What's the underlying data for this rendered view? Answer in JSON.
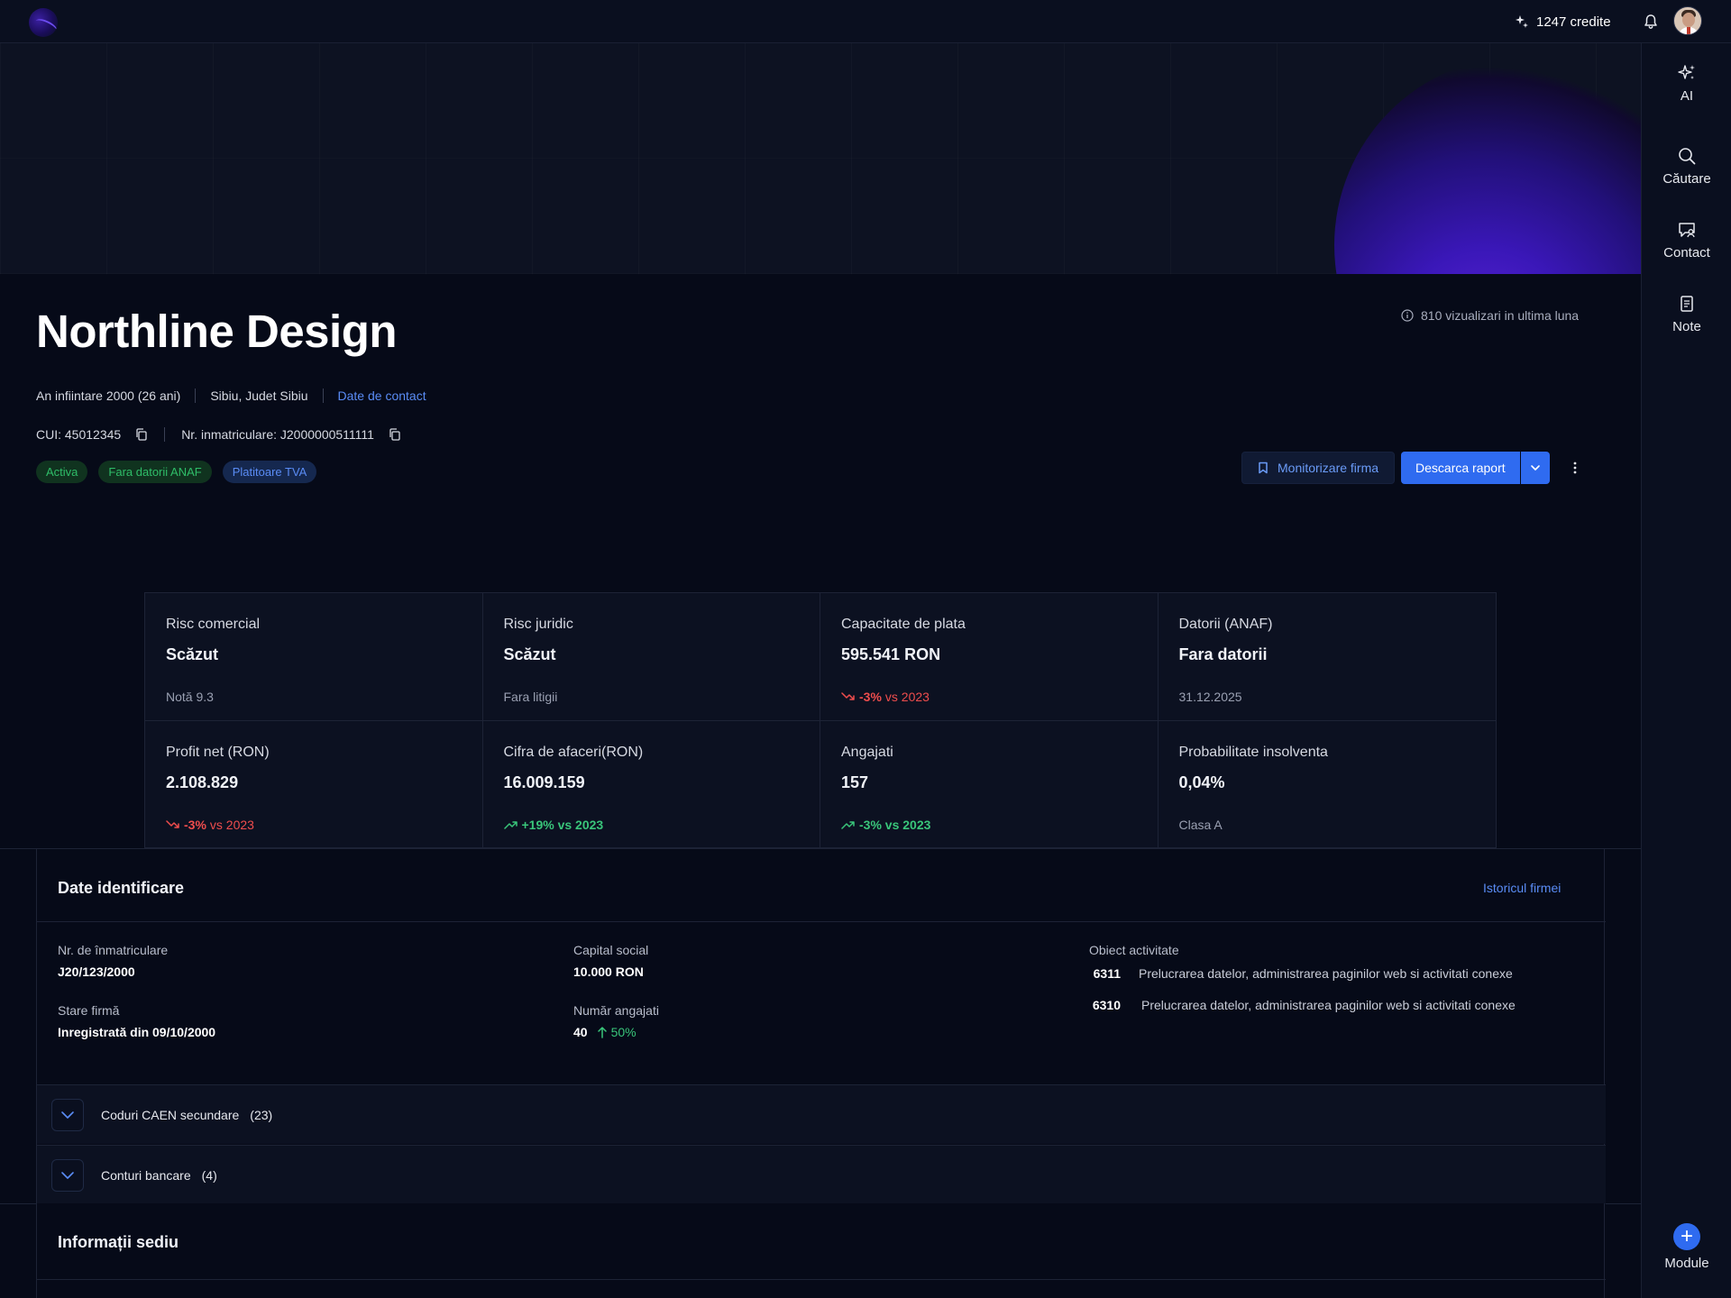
{
  "topbar": {
    "credits": "1247 credite"
  },
  "rail": {
    "items": [
      {
        "label": "AI",
        "icon": "sparkle-icon"
      },
      {
        "label": "Căutare",
        "icon": "search-icon"
      },
      {
        "label": "Contact",
        "icon": "contact-icon"
      },
      {
        "label": "Note",
        "icon": "note-icon"
      }
    ],
    "modules_label": "Module"
  },
  "company": {
    "name": "Northline Design",
    "views": "810 vizualizari in ultima luna",
    "founded": "An infiintare 2000 (26 ani)",
    "location": "Sibiu, Judet Sibiu",
    "contact_link": "Date de contact",
    "cui": "CUI: 45012345",
    "reg_no": "Nr. inmatriculare: J2000000511111",
    "tags": [
      "Activa",
      "Fara datorii ANAF",
      "Platitoare TVA"
    ]
  },
  "actions": {
    "monitor": "Monitorizare firma",
    "report": "Descarca raport"
  },
  "stats": [
    {
      "label": "Risc comercial",
      "value": "Scăzut",
      "sub": "Notă 9.3"
    },
    {
      "label": "Risc juridic",
      "value": "Scăzut",
      "sub": "Fara litigii"
    },
    {
      "label": "Capacitate de plata",
      "value": "595.541 RON",
      "delta": "-3%",
      "delta_suffix": " vs 2023"
    },
    {
      "label": "Datorii (ANAF)",
      "value": "Fara datorii",
      "sub": "31.12.2025"
    },
    {
      "label": "Profit net (RON)",
      "value": "2.108.829",
      "delta": "-3%",
      "delta_suffix": " vs 2023"
    },
    {
      "label": "Cifra de afaceri(RON)",
      "value": "16.009.159",
      "delta": "+19% vs 2023"
    },
    {
      "label": "Angajati",
      "value": "157",
      "delta": "-3% vs 2023"
    },
    {
      "label": "Probabilitate insolventa",
      "value": "0,04%",
      "sub": "Clasa A"
    }
  ],
  "identification": {
    "title": "Date identificare",
    "history_link": "Istoricul firmei",
    "reg_label": "Nr. de înmatriculare",
    "reg_value": "J20/123/2000",
    "state_label": "Stare firmă",
    "state_value": "Inregistrată din 09/10/2000",
    "capital_label": "Capital social",
    "capital_value": "10.000 RON",
    "employees_label": "Număr angajati",
    "employees_value": "40",
    "employees_growth": "50%",
    "activity_label": "Obiect activitate",
    "activities": [
      {
        "code": "6311",
        "text": "Prelucrarea datelor, administrarea paginilor web si activitati conexe"
      },
      {
        "code": "6310",
        "text": "Prelucrarea datelor, administrarea paginilor web si activitati conexe"
      }
    ]
  },
  "collapsibles": [
    {
      "label": "Coduri CAEN secundare",
      "count": "(23)"
    },
    {
      "label": "Conturi bancare",
      "count": "(4)"
    }
  ],
  "sediu": {
    "title": "Informații sediu"
  },
  "colors": {
    "accent": "#2f6bf0",
    "link": "#5a8cf5",
    "positive": "#39c57a",
    "negative": "#ef4d4d",
    "background": "#060a18"
  }
}
